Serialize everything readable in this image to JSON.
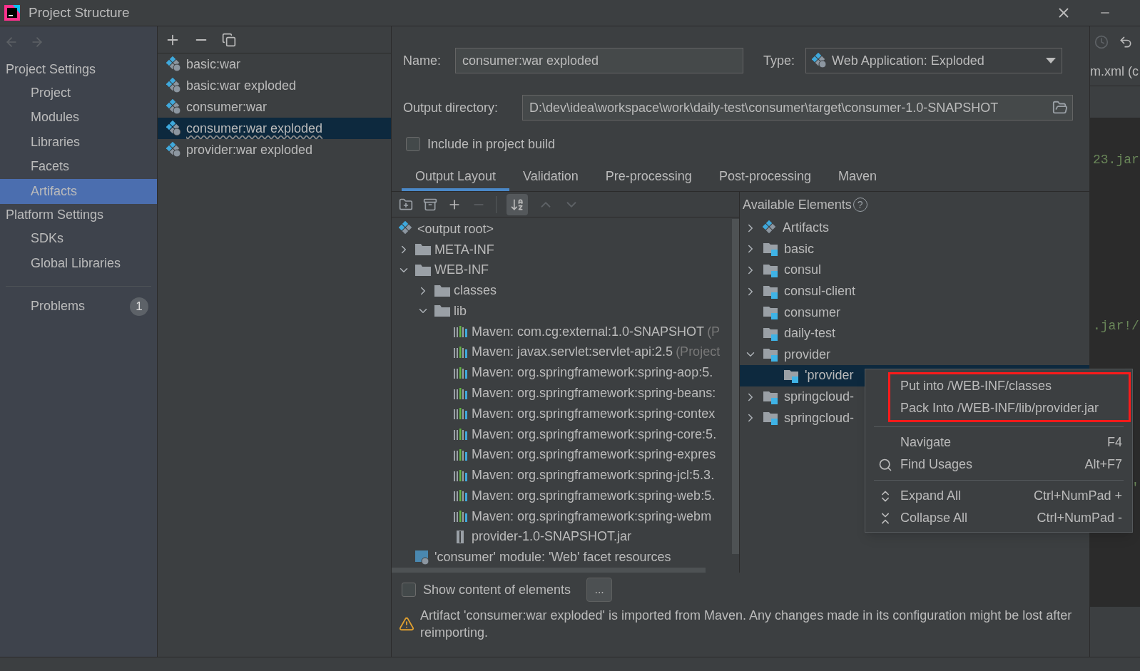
{
  "window": {
    "title": "Project Structure"
  },
  "sidebar": {
    "sections": [
      {
        "title": "Project Settings",
        "items": [
          {
            "label": "Project",
            "selected": false
          },
          {
            "label": "Modules",
            "selected": false
          },
          {
            "label": "Libraries",
            "selected": false
          },
          {
            "label": "Facets",
            "selected": false
          },
          {
            "label": "Artifacts",
            "selected": true
          }
        ]
      },
      {
        "title": "Platform Settings",
        "items": [
          {
            "label": "SDKs",
            "selected": false
          },
          {
            "label": "Global Libraries",
            "selected": false
          }
        ]
      }
    ],
    "problems": {
      "label": "Problems",
      "count": "1"
    }
  },
  "artifacts": [
    {
      "label": "basic:war",
      "selected": false
    },
    {
      "label": "basic:war exploded",
      "selected": false
    },
    {
      "label": "consumer:war",
      "selected": false
    },
    {
      "label": "consumer:war exploded",
      "selected": true
    },
    {
      "label": "provider:war exploded",
      "selected": false
    }
  ],
  "name": {
    "label": "Name:",
    "value": "consumer:war exploded"
  },
  "type": {
    "label": "Type:",
    "value": "Web Application: Exploded"
  },
  "output_directory": {
    "label": "Output directory:",
    "value": "D:\\dev\\idea\\workspace\\work\\daily-test\\consumer\\target\\consumer-1.0-SNAPSHOT"
  },
  "include_in_build": {
    "label": "Include in project build",
    "checked": false
  },
  "tabs": [
    {
      "label": "Output Layout",
      "selected": true
    },
    {
      "label": "Validation",
      "selected": false
    },
    {
      "label": "Pre-processing",
      "selected": false
    },
    {
      "label": "Post-processing",
      "selected": false
    },
    {
      "label": "Maven",
      "selected": false
    }
  ],
  "layout_tree": [
    {
      "kind": "root",
      "label": "<output root>",
      "children": [
        {
          "kind": "folder",
          "label": "META-INF",
          "expanded": false
        },
        {
          "kind": "folder",
          "label": "WEB-INF",
          "expanded": true,
          "children": [
            {
              "kind": "folder",
              "label": "classes",
              "expanded": false
            },
            {
              "kind": "folder",
              "label": "lib",
              "expanded": true,
              "children": [
                {
                  "kind": "library",
                  "label": "Maven: com.cg:external:1.0-SNAPSHOT",
                  "note": "(P"
                },
                {
                  "kind": "library",
                  "label": "Maven: javax.servlet:servlet-api:2.5",
                  "note": "(Project"
                },
                {
                  "kind": "library",
                  "label": "Maven: org.springframework:spring-aop:5."
                },
                {
                  "kind": "library",
                  "label": "Maven: org.springframework:spring-beans:"
                },
                {
                  "kind": "library",
                  "label": "Maven: org.springframework:spring-contex"
                },
                {
                  "kind": "library",
                  "label": "Maven: org.springframework:spring-core:5."
                },
                {
                  "kind": "library",
                  "label": "Maven: org.springframework:spring-expres"
                },
                {
                  "kind": "library",
                  "label": "Maven: org.springframework:spring-jcl:5.3."
                },
                {
                  "kind": "library",
                  "label": "Maven: org.springframework:spring-web:5."
                },
                {
                  "kind": "library",
                  "label": "Maven: org.springframework:spring-webm"
                },
                {
                  "kind": "jar",
                  "label": "provider-1.0-SNAPSHOT.jar"
                }
              ]
            }
          ]
        },
        {
          "kind": "facet",
          "label": "'consumer' module: 'Web' facet resources"
        }
      ]
    }
  ],
  "available": {
    "title": "Available Elements",
    "help": "?",
    "items": [
      {
        "kind": "artifacts",
        "label": "Artifacts",
        "expanded": false,
        "selected": false
      },
      {
        "kind": "module",
        "label": "basic",
        "expanded": false,
        "selected": false
      },
      {
        "kind": "module",
        "label": "consul",
        "expanded": false,
        "selected": false
      },
      {
        "kind": "module",
        "label": "consul-client",
        "expanded": false,
        "selected": false
      },
      {
        "kind": "module-leaf",
        "label": "consumer",
        "selected": false
      },
      {
        "kind": "module-leaf",
        "label": "daily-test",
        "selected": false
      },
      {
        "kind": "module",
        "label": "provider",
        "expanded": true,
        "selected": false,
        "children": [
          {
            "kind": "module-leaf",
            "label": "'provider",
            "selected": true
          }
        ]
      },
      {
        "kind": "module",
        "label": "springcloud-",
        "expanded": false,
        "selected": false
      },
      {
        "kind": "module",
        "label": "springcloud-",
        "expanded": false,
        "selected": false
      }
    ]
  },
  "show_content": {
    "label": "Show content of elements",
    "checked": false,
    "button": "..."
  },
  "warning": "Artifact 'consumer:war exploded' is imported from Maven. Any changes made in its configuration might be lost after reimporting.",
  "context_menu": {
    "groups": [
      {
        "annotated": true,
        "items": [
          {
            "kind": "plain",
            "label": "Put into /WEB-INF/classes"
          },
          {
            "kind": "plain",
            "label": "Pack Into /WEB-INF/lib/provider.jar"
          }
        ]
      },
      {
        "annotated": false,
        "items": [
          {
            "kind": "plain",
            "label": "Navigate",
            "shortcut": "F4"
          },
          {
            "kind": "search",
            "label": "Find Usages",
            "shortcut": "Alt+F7"
          }
        ]
      },
      {
        "annotated": false,
        "items": [
          {
            "kind": "expand",
            "label": "Expand All",
            "shortcut": "Ctrl+NumPad +"
          },
          {
            "kind": "collapse",
            "label": "Collapse All",
            "shortcut": "Ctrl+NumPad -"
          }
        ]
      }
    ]
  },
  "editor": {
    "tab": "m.xml (c",
    "fragments": [
      "23.jar",
      ".jar!/",
      "'"
    ]
  }
}
